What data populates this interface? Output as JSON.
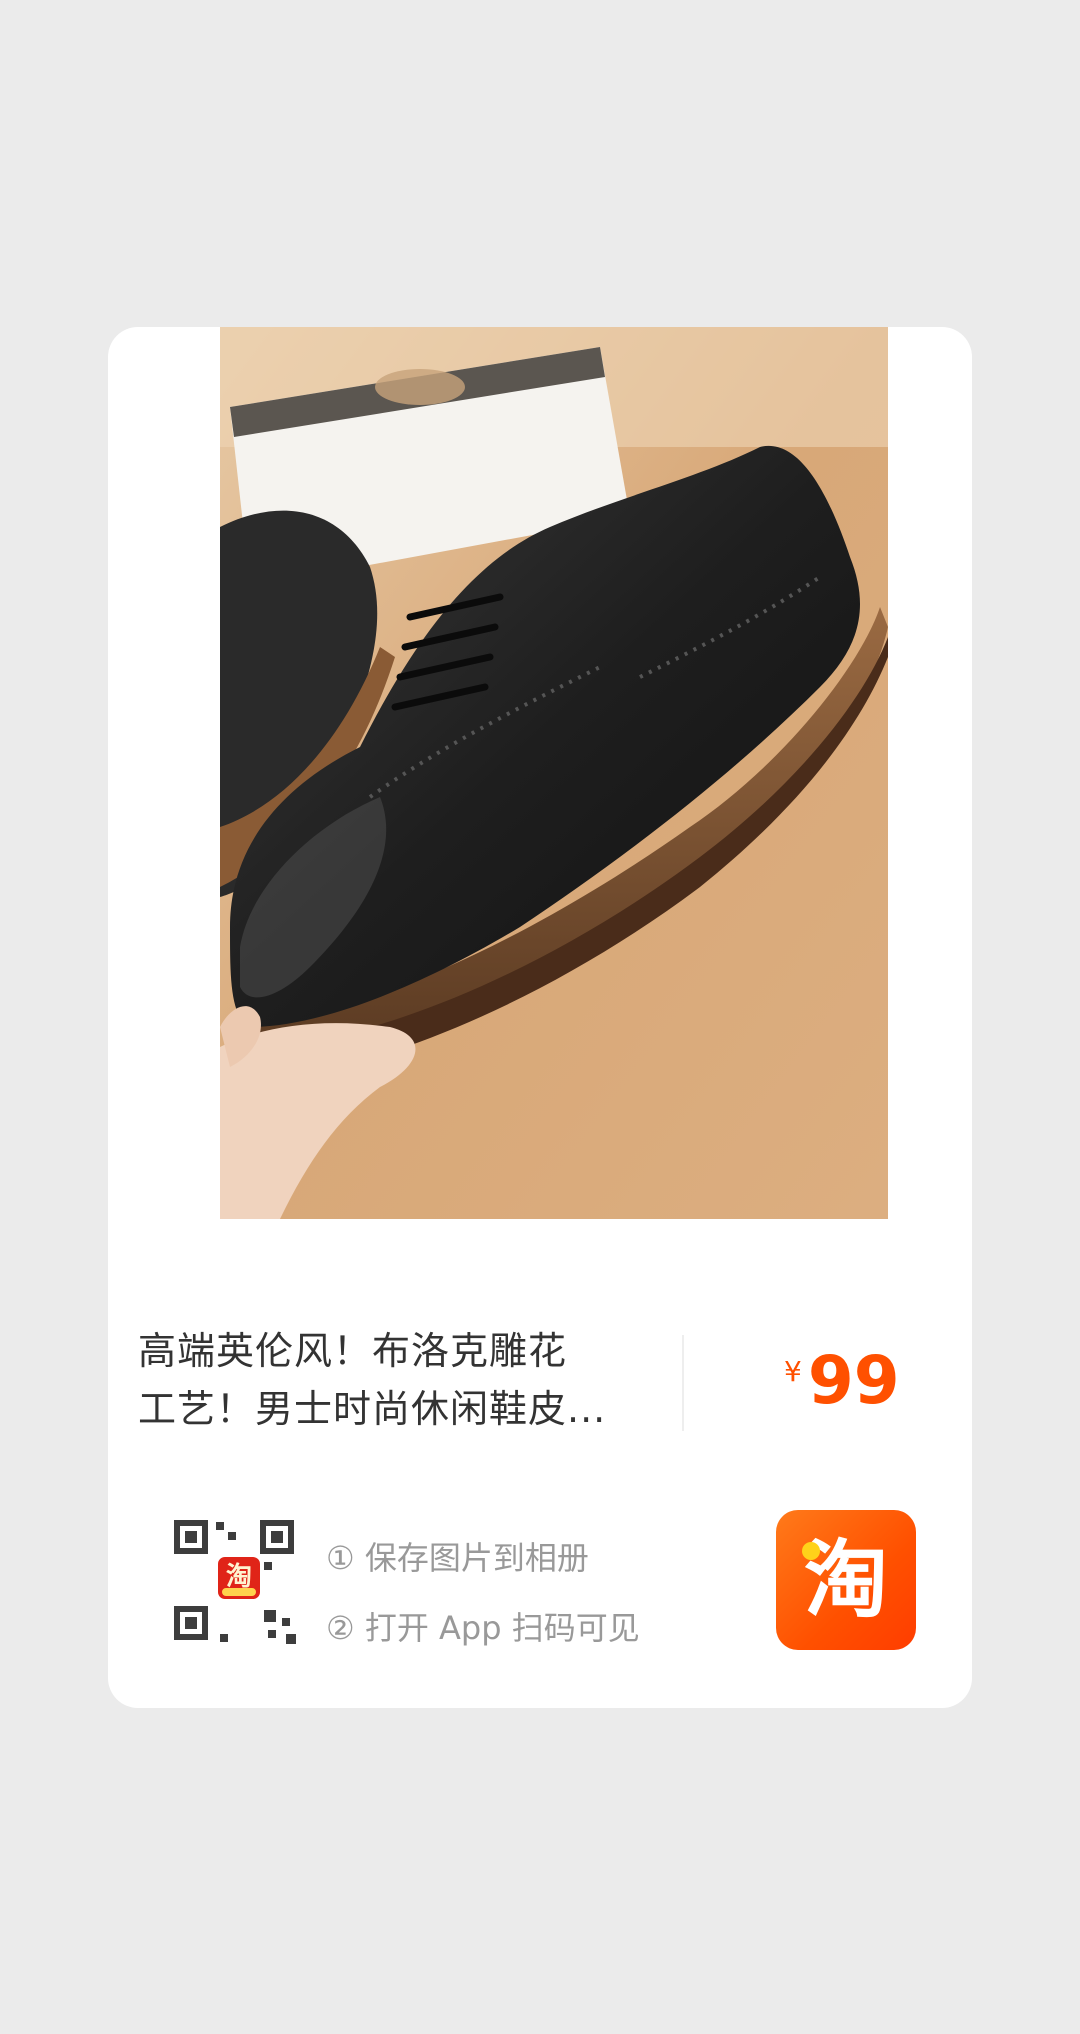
{
  "product": {
    "image_alt": "black brogue leather shoe",
    "title_line1": "高端英伦风！布洛克雕花",
    "title_line2": "工艺！男士时尚休闲鞋皮...",
    "currency": "¥",
    "price": "99"
  },
  "qr": {
    "logo_char": "淘"
  },
  "steps": [
    "① 保存图片到相册",
    "② 打开 App 扫码可见"
  ],
  "app_icon": {
    "label": "淘"
  },
  "colors": {
    "background": "#ebebeb",
    "card": "#ffffff",
    "price": "#ff5000",
    "brand_orange": "#ff5000"
  }
}
